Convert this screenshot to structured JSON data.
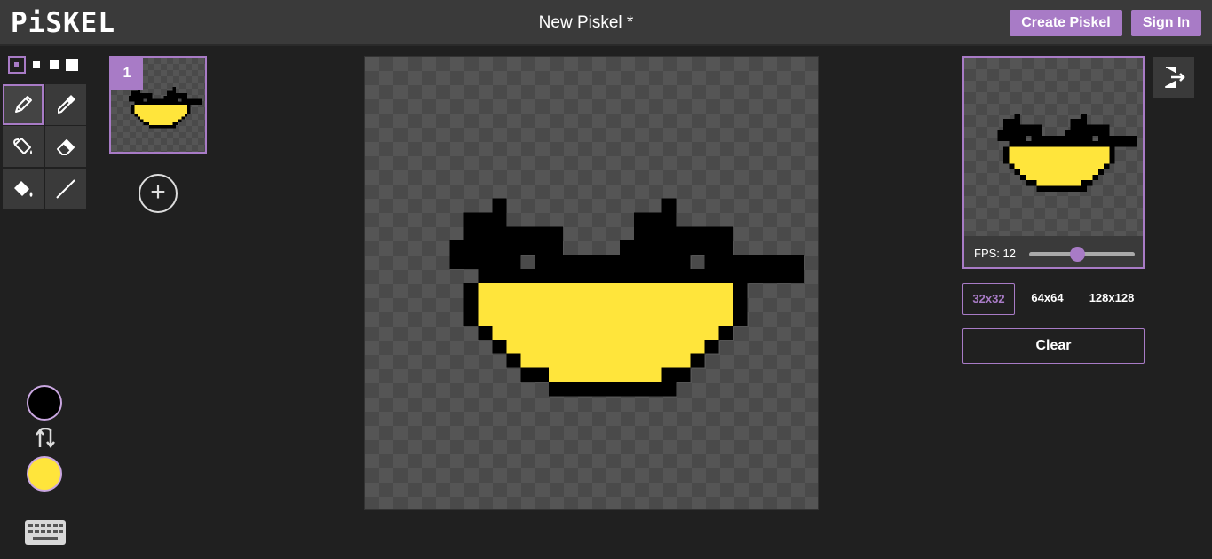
{
  "app": {
    "logo": "PiSKEL",
    "title": "New Piskel *"
  },
  "header": {
    "create_label": "Create Piskel",
    "signin_label": "Sign In"
  },
  "tools": {
    "pen_sizes": [
      "1",
      "2",
      "3",
      "4"
    ],
    "selected_pen_size": 1,
    "items": [
      {
        "name": "pen-tool",
        "icon": "pencil-icon",
        "selected": true
      },
      {
        "name": "color-picker-tool",
        "icon": "eyedropper-icon",
        "selected": false
      },
      {
        "name": "paint-bucket-tool",
        "icon": "paint-bucket-icon",
        "selected": false
      },
      {
        "name": "eraser-tool",
        "icon": "eraser-icon",
        "selected": false
      },
      {
        "name": "color-fill-tool",
        "icon": "fill-drop-icon",
        "selected": false
      },
      {
        "name": "line-tool",
        "icon": "line-icon",
        "selected": false
      }
    ]
  },
  "frames": {
    "items": [
      {
        "number": "1"
      }
    ],
    "add_icon": "plus-icon"
  },
  "colors": {
    "primary": "#000000",
    "secondary": "#ffe53b",
    "accent": "#a87bc6"
  },
  "preview": {
    "fps_label": "FPS: 12",
    "fps": 12,
    "fps_fraction": 0.46
  },
  "resize": {
    "options": [
      "32x32",
      "64x64",
      "128x128"
    ],
    "selected": "32x32"
  },
  "actions": {
    "clear_label": "Clear",
    "export_icon": "export-icon",
    "keyboard_icon": "keyboard-icon",
    "swap_icon": "swap-colors-icon"
  },
  "sprite": {
    "grid": 32,
    "black": [
      [
        9,
        10,
        1,
        2
      ],
      [
        7,
        11,
        3,
        2
      ],
      [
        6,
        13,
        5,
        2
      ],
      [
        10,
        12,
        4,
        2
      ],
      [
        12,
        14,
        7,
        2
      ],
      [
        21,
        10,
        1,
        2
      ],
      [
        19,
        11,
        3,
        2
      ],
      [
        18,
        13,
        5,
        2
      ],
      [
        22,
        12,
        4,
        2
      ],
      [
        24,
        14,
        7,
        2
      ],
      [
        8,
        15,
        18,
        1
      ],
      [
        7,
        16,
        1,
        3
      ],
      [
        26,
        16,
        1,
        3
      ],
      [
        8,
        19,
        1,
        1
      ],
      [
        25,
        19,
        1,
        1
      ],
      [
        9,
        20,
        1,
        1
      ],
      [
        24,
        20,
        1,
        1
      ],
      [
        10,
        21,
        1,
        1
      ],
      [
        23,
        21,
        1,
        1
      ],
      [
        11,
        22,
        2,
        1
      ],
      [
        21,
        22,
        2,
        1
      ],
      [
        13,
        23,
        9,
        1
      ]
    ],
    "yellow": [
      [
        8,
        16,
        18,
        3
      ],
      [
        9,
        19,
        16,
        1
      ],
      [
        10,
        20,
        14,
        1
      ],
      [
        11,
        21,
        12,
        1
      ],
      [
        13,
        22,
        8,
        1
      ]
    ]
  }
}
